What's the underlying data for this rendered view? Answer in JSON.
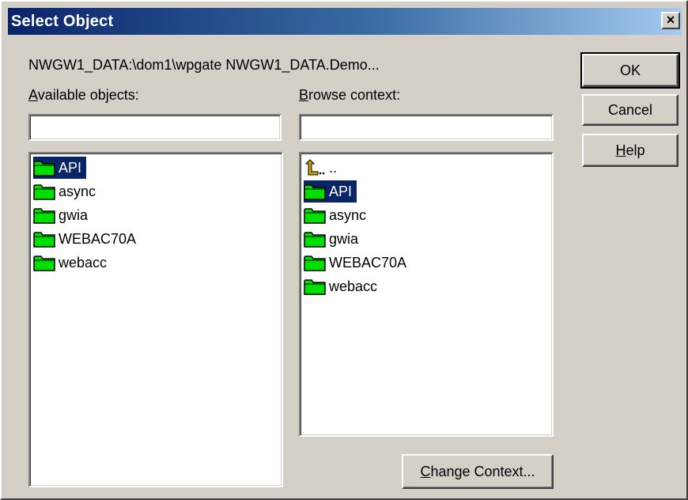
{
  "window": {
    "title": "Select Object",
    "close_glyph": "×"
  },
  "path_text": "NWGW1_DATA:\\dom1\\wpgate NWGW1_DATA.Demo...",
  "available": {
    "label_mnemonic": "A",
    "label_rest": "vailable objects:",
    "filter_value": "",
    "items": [
      {
        "label": "API",
        "selected": true,
        "icon": "folder-icon"
      },
      {
        "label": "async",
        "selected": false,
        "icon": "folder-icon"
      },
      {
        "label": "gwia",
        "selected": false,
        "icon": "folder-icon"
      },
      {
        "label": "WEBAC70A",
        "selected": false,
        "icon": "folder-icon"
      },
      {
        "label": "webacc",
        "selected": false,
        "icon": "folder-icon"
      }
    ]
  },
  "browse": {
    "label_mnemonic": "B",
    "label_rest": "rowse context:",
    "filter_value": "",
    "up_label": "..",
    "items": [
      {
        "label": "API",
        "selected": true,
        "icon": "folder-icon"
      },
      {
        "label": "async",
        "selected": false,
        "icon": "folder-icon"
      },
      {
        "label": "gwia",
        "selected": false,
        "icon": "folder-icon"
      },
      {
        "label": "WEBAC70A",
        "selected": false,
        "icon": "folder-icon"
      },
      {
        "label": "webacc",
        "selected": false,
        "icon": "folder-icon"
      }
    ]
  },
  "buttons": {
    "ok": "OK",
    "cancel": "Cancel",
    "help_mnemonic": "H",
    "help_rest": "elp",
    "change_context_mnemonic": "C",
    "change_context_rest": "hange Context..."
  },
  "colors": {
    "selection": "#0a246a",
    "folder_fill": "#00e000",
    "dialog_face": "#d4d0c8"
  }
}
